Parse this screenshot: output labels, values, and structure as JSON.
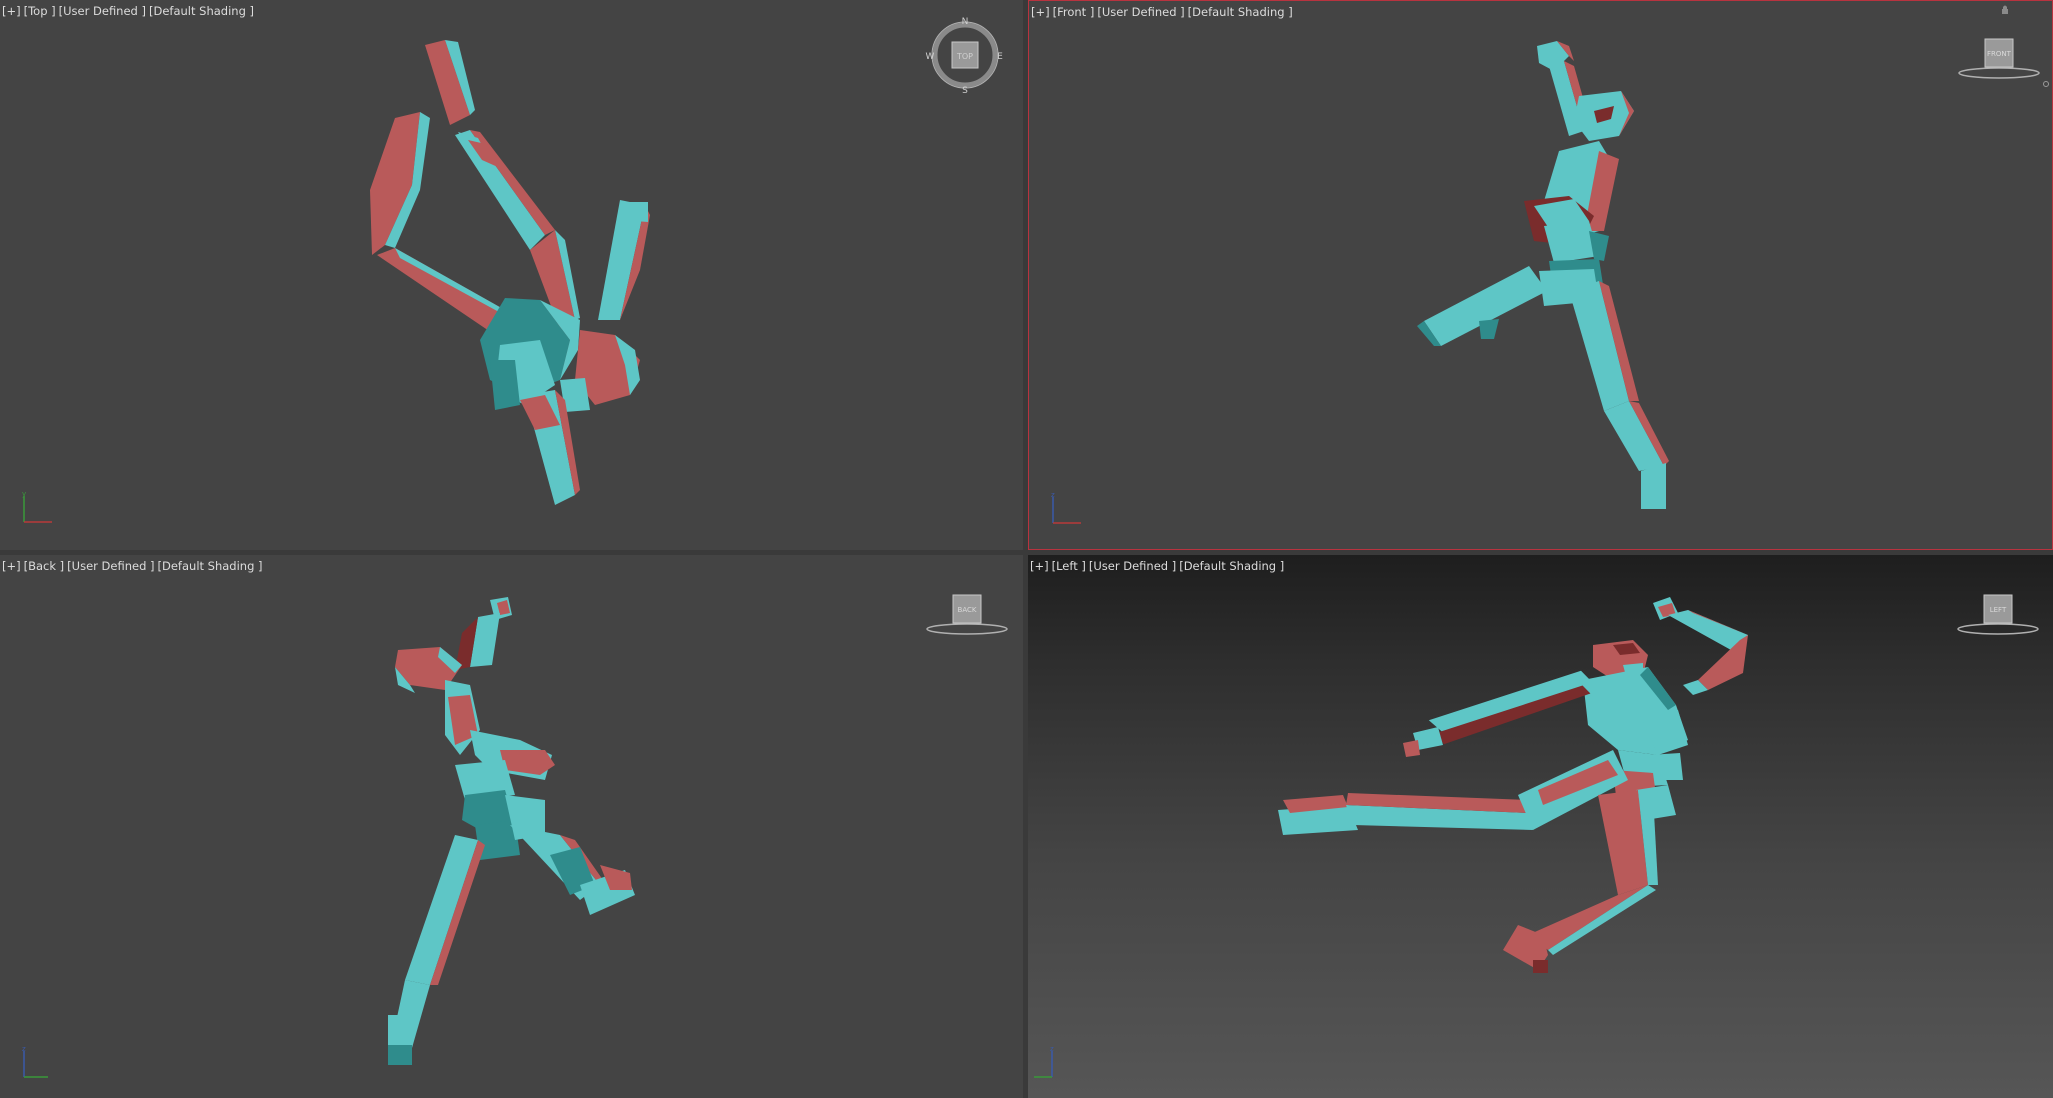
{
  "colors": {
    "cyan": "#5ec6c6",
    "cyan_dark": "#2f8c8c",
    "red": "#b95a5a",
    "red_dark": "#7a2c2c",
    "active_border": "#b8333f",
    "viewport_bg": "#444444"
  },
  "viewports": {
    "top": {
      "plus": "[+]",
      "view": "[Top ]",
      "mode": "[User Defined ]",
      "shading": "[Default Shading ]",
      "compass": {
        "n": "N",
        "s": "S",
        "e": "E",
        "w": "W",
        "cube": "TOP"
      }
    },
    "front": {
      "plus": "[+]",
      "view": "[Front ]",
      "mode": "[User Defined ]",
      "shading": "[Default Shading ]",
      "cube": "FRONT",
      "active": true
    },
    "back": {
      "plus": "[+]",
      "view": "[Back ]",
      "mode": "[User Defined ]",
      "shading": "[Default Shading ]",
      "cube": "BACK"
    },
    "left": {
      "plus": "[+]",
      "view": "[Left ]",
      "mode": "[User Defined ]",
      "shading": "[Default Shading ]",
      "cube": "LEFT"
    }
  }
}
